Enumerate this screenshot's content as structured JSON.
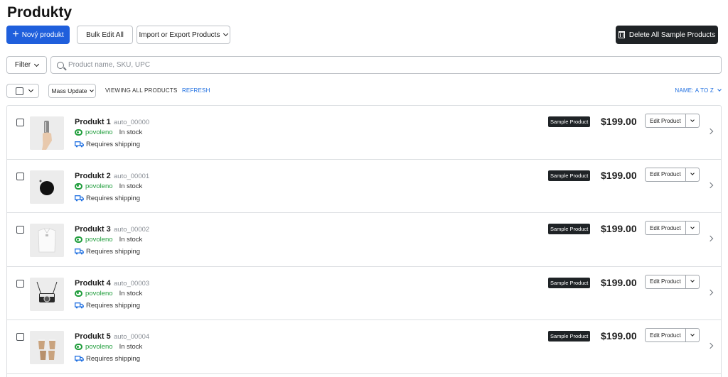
{
  "page": {
    "title": "Produkty"
  },
  "toolbar": {
    "new_product": "Nový produkt",
    "bulk_edit": "Bulk Edit All",
    "import_export": "Import or Export Products",
    "delete_samples": "Delete All Sample Products"
  },
  "filter": {
    "label": "Filter"
  },
  "search": {
    "placeholder": "Product name, SKU, UPC",
    "value": ""
  },
  "list_controls": {
    "mass_update": "Mass Update",
    "viewing": "VIEWING ALL PRODUCTS",
    "refresh": "REFRESH",
    "sort": "NAME: A TO Z"
  },
  "products": [
    {
      "name": "Produkt 1",
      "sku": "auto_00000",
      "status": "povoleno",
      "stock": "In stock",
      "shipping": "Requires shipping",
      "badge": "Sample Product",
      "price": "$199.00",
      "edit": "Edit Product",
      "thumb": "bottle-hand"
    },
    {
      "name": "Produkt 2",
      "sku": "auto_00001",
      "status": "povoleno",
      "stock": "In stock",
      "shipping": "Requires shipping",
      "badge": "Sample Product",
      "price": "$199.00",
      "edit": "Edit Product",
      "thumb": "black-circle"
    },
    {
      "name": "Produkt 3",
      "sku": "auto_00002",
      "status": "povoleno",
      "stock": "In stock",
      "shipping": "Requires shipping",
      "badge": "Sample Product",
      "price": "$199.00",
      "edit": "Edit Product",
      "thumb": "white-shirt"
    },
    {
      "name": "Produkt 4",
      "sku": "auto_00003",
      "status": "povoleno",
      "stock": "In stock",
      "shipping": "Requires shipping",
      "badge": "Sample Product",
      "price": "$199.00",
      "edit": "Edit Product",
      "thumb": "camera"
    },
    {
      "name": "Produkt 5",
      "sku": "auto_00004",
      "status": "povoleno",
      "stock": "In stock",
      "shipping": "Requires shipping",
      "badge": "Sample Product",
      "price": "$199.00",
      "edit": "Edit Product",
      "thumb": "cups"
    }
  ],
  "colors": {
    "primary": "#1f5fdc",
    "dark": "#1f2326",
    "enabled_green": "#1f9d3b",
    "link_blue": "#1f6fe0",
    "border": "#bfc3c8"
  }
}
